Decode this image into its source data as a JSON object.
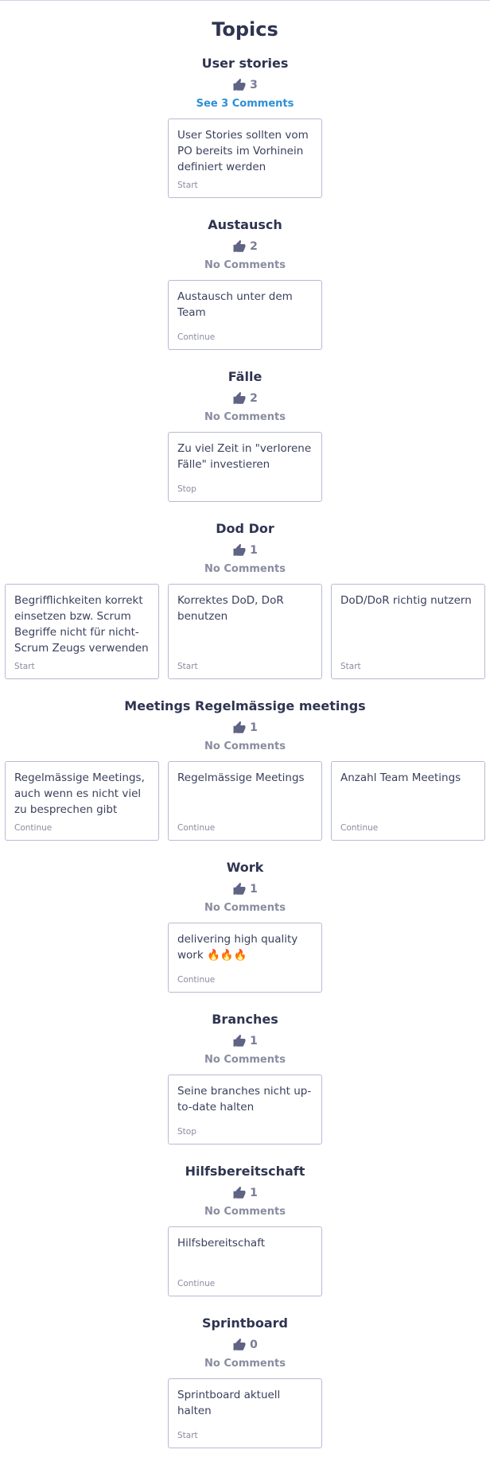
{
  "page_title": "Topics",
  "colors": {
    "link": "#2d8fd6",
    "card_border": "#b7bad5",
    "muted": "#8a8ca0",
    "heading": "#2f3450"
  },
  "vote_icon": "thumbs-up-icon",
  "topics": [
    {
      "title": "User stories",
      "votes": "3",
      "comments": "See 3 Comments",
      "comments_is_link": true,
      "cards": [
        {
          "text": "User Stories sollten vom PO bereits im Vorhinein definiert werden",
          "tag": "Start"
        }
      ]
    },
    {
      "title": "Austausch",
      "votes": "2",
      "comments": "No Comments",
      "cards": [
        {
          "text": "Austausch unter dem Team",
          "tag": "Continue"
        }
      ]
    },
    {
      "title": "Fälle",
      "votes": "2",
      "comments": "No Comments",
      "cards": [
        {
          "text": "Zu viel Zeit in \"verlorene Fälle\" investieren",
          "tag": "Stop"
        }
      ]
    },
    {
      "title": "Dod Dor",
      "votes": "1",
      "comments": "No Comments",
      "cards": [
        {
          "text": "Begrifflichkeiten korrekt einsetzen bzw. Scrum Begriffe nicht für nicht-Scrum Zeugs verwenden",
          "tag": "Start"
        },
        {
          "text": "Korrektes DoD, DoR benutzen",
          "tag": "Start"
        },
        {
          "text": "DoD/DoR richtig nutzern",
          "tag": "Start"
        }
      ]
    },
    {
      "title": "Meetings Regelmässige meetings",
      "votes": "1",
      "comments": "No Comments",
      "cards": [
        {
          "text": "Regelmässige Meetings, auch wenn es nicht viel zu besprechen gibt",
          "tag": "Continue"
        },
        {
          "text": "Regelmässige Meetings",
          "tag": "Continue"
        },
        {
          "text": "Anzahl Team Meetings",
          "tag": "Continue"
        }
      ]
    },
    {
      "title": "Work",
      "votes": "1",
      "comments": "No Comments",
      "cards": [
        {
          "text": "delivering high quality work 🔥🔥🔥",
          "tag": "Continue"
        }
      ]
    },
    {
      "title": "Branches",
      "votes": "1",
      "comments": "No Comments",
      "cards": [
        {
          "text": "Seine branches nicht up-to-date halten",
          "tag": "Stop"
        }
      ]
    },
    {
      "title": "Hilfsbereitschaft",
      "votes": "1",
      "comments": "No Comments",
      "cards": [
        {
          "text": "Hilfsbereitschaft",
          "tag": "Continue"
        }
      ]
    },
    {
      "title": "Sprintboard",
      "votes": "0",
      "comments": "No Comments",
      "cards": [
        {
          "text": "Sprintboard aktuell halten",
          "tag": "Start"
        }
      ]
    }
  ]
}
